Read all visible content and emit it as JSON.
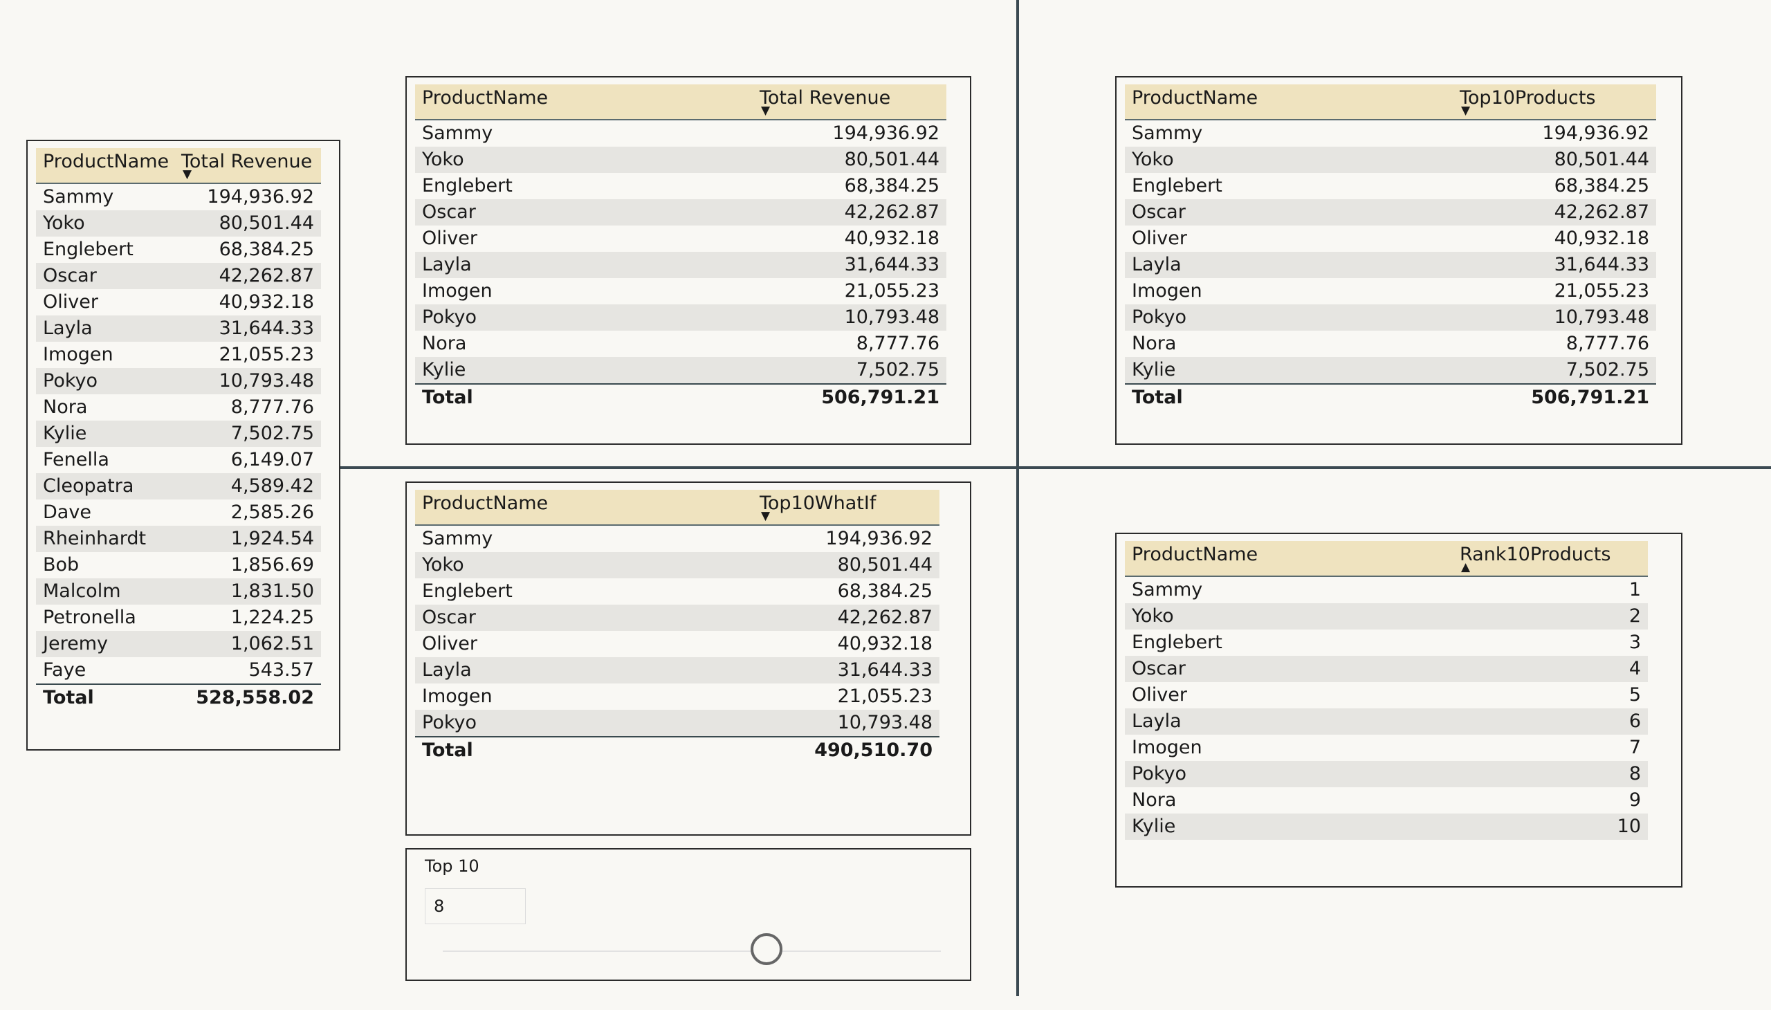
{
  "table1": {
    "col1": "ProductName",
    "col2": "Total Revenue",
    "rows": [
      [
        "Sammy",
        "194,936.92"
      ],
      [
        "Yoko",
        "80,501.44"
      ],
      [
        "Englebert",
        "68,384.25"
      ],
      [
        "Oscar",
        "42,262.87"
      ],
      [
        "Oliver",
        "40,932.18"
      ],
      [
        "Layla",
        "31,644.33"
      ],
      [
        "Imogen",
        "21,055.23"
      ],
      [
        "Pokyo",
        "10,793.48"
      ],
      [
        "Nora",
        "8,777.76"
      ],
      [
        "Kylie",
        "7,502.75"
      ],
      [
        "Fenella",
        "6,149.07"
      ],
      [
        "Cleopatra",
        "4,589.42"
      ],
      [
        "Dave",
        "2,585.26"
      ],
      [
        "Rheinhardt",
        "1,924.54"
      ],
      [
        "Bob",
        "1,856.69"
      ],
      [
        "Malcolm",
        "1,831.50"
      ],
      [
        "Petronella",
        "1,224.25"
      ],
      [
        "Jeremy",
        "1,062.51"
      ],
      [
        "Faye",
        "543.57"
      ]
    ],
    "total_label": "Total",
    "total_value": "528,558.02"
  },
  "table2": {
    "col1": "ProductName",
    "col2": "Total Revenue",
    "rows": [
      [
        "Sammy",
        "194,936.92"
      ],
      [
        "Yoko",
        "80,501.44"
      ],
      [
        "Englebert",
        "68,384.25"
      ],
      [
        "Oscar",
        "42,262.87"
      ],
      [
        "Oliver",
        "40,932.18"
      ],
      [
        "Layla",
        "31,644.33"
      ],
      [
        "Imogen",
        "21,055.23"
      ],
      [
        "Pokyo",
        "10,793.48"
      ],
      [
        "Nora",
        "8,777.76"
      ],
      [
        "Kylie",
        "7,502.75"
      ]
    ],
    "total_label": "Total",
    "total_value": "506,791.21"
  },
  "table3": {
    "col1": "ProductName",
    "col2": "Top10Products",
    "rows": [
      [
        "Sammy",
        "194,936.92"
      ],
      [
        "Yoko",
        "80,501.44"
      ],
      [
        "Englebert",
        "68,384.25"
      ],
      [
        "Oscar",
        "42,262.87"
      ],
      [
        "Oliver",
        "40,932.18"
      ],
      [
        "Layla",
        "31,644.33"
      ],
      [
        "Imogen",
        "21,055.23"
      ],
      [
        "Pokyo",
        "10,793.48"
      ],
      [
        "Nora",
        "8,777.76"
      ],
      [
        "Kylie",
        "7,502.75"
      ]
    ],
    "total_label": "Total",
    "total_value": "506,791.21"
  },
  "table4": {
    "col1": "ProductName",
    "col2": "Top10WhatIf",
    "rows": [
      [
        "Sammy",
        "194,936.92"
      ],
      [
        "Yoko",
        "80,501.44"
      ],
      [
        "Englebert",
        "68,384.25"
      ],
      [
        "Oscar",
        "42,262.87"
      ],
      [
        "Oliver",
        "40,932.18"
      ],
      [
        "Layla",
        "31,644.33"
      ],
      [
        "Imogen",
        "21,055.23"
      ],
      [
        "Pokyo",
        "10,793.48"
      ]
    ],
    "total_label": "Total",
    "total_value": "490,510.70"
  },
  "table5": {
    "col1": "ProductName",
    "col2": "Rank10Products",
    "rows": [
      [
        "Sammy",
        "1"
      ],
      [
        "Yoko",
        "2"
      ],
      [
        "Englebert",
        "3"
      ],
      [
        "Oscar",
        "4"
      ],
      [
        "Oliver",
        "5"
      ],
      [
        "Layla",
        "6"
      ],
      [
        "Imogen",
        "7"
      ],
      [
        "Pokyo",
        "8"
      ],
      [
        "Nora",
        "9"
      ],
      [
        "Kylie",
        "10"
      ]
    ]
  },
  "slicer": {
    "title": "Top 10",
    "value": "8",
    "slider_fraction": 0.65
  },
  "icons": {
    "sort_desc": "sort-descending-icon",
    "sort_asc": "sort-ascending-icon"
  }
}
